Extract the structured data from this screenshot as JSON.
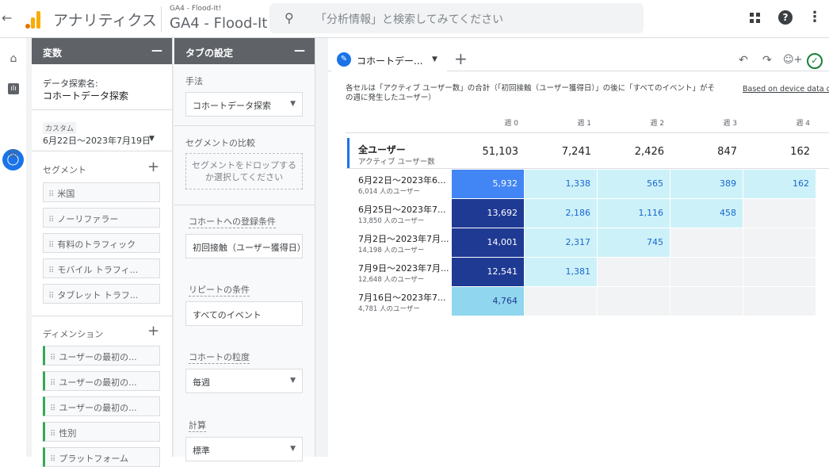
{
  "topbar": {
    "back_icon": "arrow-back-icon",
    "app_title": "アナリティクス",
    "property_small": "GA4 - Flood-It!",
    "property_big": "GA4 - Flood-It!",
    "search_placeholder": "「分析情報」と検索してみてください",
    "brand_colors": [
      "#f9ab00",
      "#e37400"
    ]
  },
  "rail": {
    "items": [
      "home-icon",
      "reports-icon",
      "explore-icon",
      "advertising-icon"
    ],
    "active": "explore-icon",
    "accent": "#1a73e8"
  },
  "variables": {
    "title": "変数",
    "exploration_name_label": "データ探索名:",
    "exploration_name": "コホートデータ探索",
    "date_custom_label": "カスタム",
    "date_range": "6月22日～2023年7月19日",
    "segments_title": "セグメント",
    "segments": [
      "米国",
      "ノーリファラー",
      "有料のトラフィック",
      "モバイル トラフィ...",
      "タブレット トラフ..."
    ],
    "dimensions_title": "ディメンション",
    "dimensions": [
      "ユーザーの最初の...",
      "ユーザーの最初の...",
      "ユーザーの最初の...",
      "性別",
      "プラットフォーム"
    ]
  },
  "tab_settings": {
    "title": "タブの設定",
    "technique_label": "手法",
    "technique_value": "コホートデータ探索",
    "segment_compare_label": "セグメントの比較",
    "segment_dropzone": "セグメントをドロップするか選択してください",
    "cohort_inclusion_label": "コホートへの登録条件",
    "cohort_inclusion_value": "初回接触（ユーザー獲得日）",
    "return_criteria_label": "リピートの条件",
    "return_criteria_value": "すべてのイベント",
    "cohort_granularity_label": "コホートの粒度",
    "cohort_granularity_value": "毎週",
    "calculation_label": "計算",
    "calculation_value": "標準"
  },
  "canvas": {
    "tab_label": "コホートデー...",
    "description": "各セルは「アクティブ ユーザー数」の合計（「初回接触（ユーザー獲得日）」の後に「すべてのイベント」がその週に発生したユーザー）",
    "based_on": "Based on device data only",
    "columns": [
      "週 0",
      "週 1",
      "週 2",
      "週 3",
      "週 4"
    ],
    "total": {
      "label": "全ユーザー",
      "sublabel": "アクティブ ユーザー数",
      "values": [
        "51,103",
        "7,241",
        "2,426",
        "847",
        "162"
      ]
    },
    "rows": [
      {
        "label": "6月22日～2023年6...",
        "sub": "6,014 人のユーザー",
        "cells": [
          "5,932",
          "1,338",
          "565",
          "389",
          "162"
        ]
      },
      {
        "label": "6月25日～2023年7...",
        "sub": "13,850 人のユーザー",
        "cells": [
          "13,692",
          "2,186",
          "1,116",
          "458",
          ""
        ]
      },
      {
        "label": "7月2日～2023年7月...",
        "sub": "14,198 人のユーザー",
        "cells": [
          "14,001",
          "2,317",
          "745",
          "",
          ""
        ]
      },
      {
        "label": "7月9日～2023年7月...",
        "sub": "12,648 人のユーザー",
        "cells": [
          "12,541",
          "1,381",
          "",
          "",
          ""
        ]
      },
      {
        "label": "7月16日～2023年7...",
        "sub": "4,781 人のユーザー",
        "cells": [
          "4,764",
          "",
          "",
          "",
          ""
        ]
      }
    ]
  }
}
